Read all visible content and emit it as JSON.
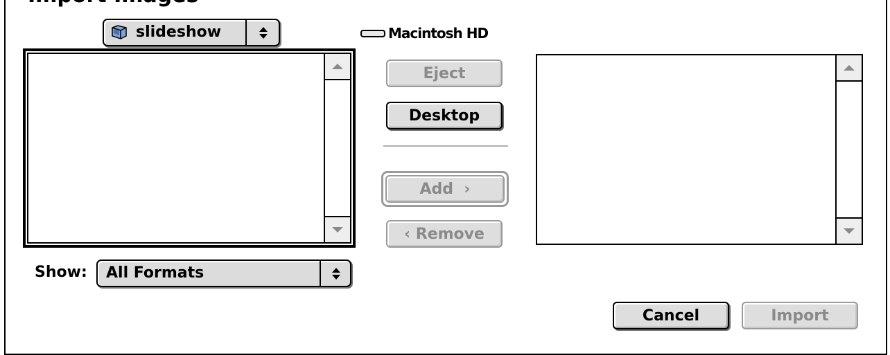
{
  "dialog": {
    "title_fragment": "Import Images"
  },
  "folder_popup": {
    "label": "slideshow"
  },
  "volume": {
    "name": "Macintosh HD"
  },
  "buttons": {
    "eject": "Eject",
    "desktop": "Desktop",
    "add": "Add  ›",
    "remove": "‹ Remove",
    "cancel": "Cancel",
    "import": "Import"
  },
  "show": {
    "label": "Show:",
    "selected": "All Formats"
  },
  "colors": {
    "disabled_text": "#8a8a8a",
    "button_face": "#dedede"
  },
  "icons": [
    "folder-icon",
    "disk-icon",
    "popup-arrows-icon",
    "scroll-up-arrow-icon",
    "scroll-down-arrow-icon"
  ]
}
